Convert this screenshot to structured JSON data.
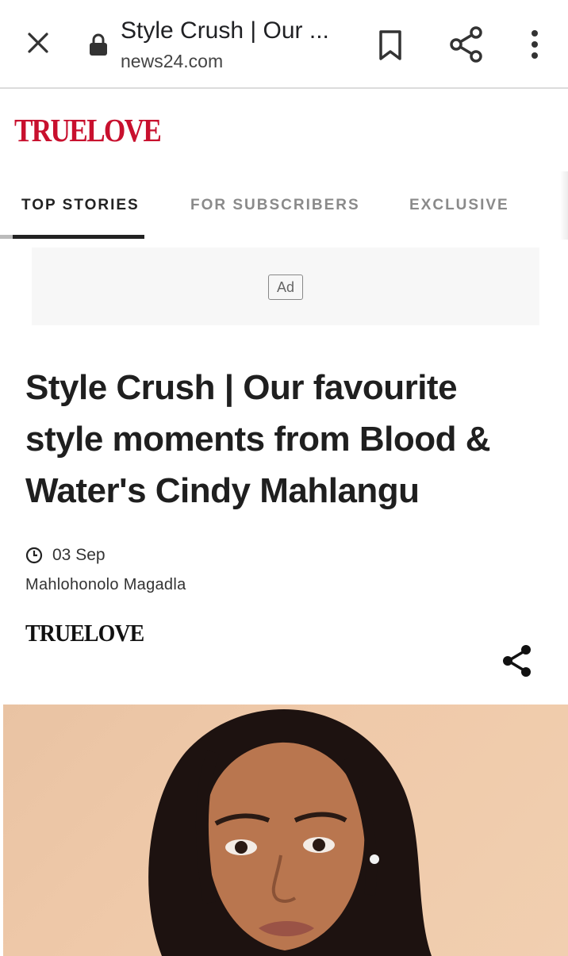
{
  "browser": {
    "page_title": "Style Crush | Our ...",
    "url": "news24.com",
    "icons": {
      "close": "close-icon",
      "lock": "lock-icon",
      "bookmark": "bookmark-icon",
      "share": "share-icon",
      "more": "more-vert-icon"
    }
  },
  "brand": {
    "logo_text": "TRUELOVE",
    "color": "#c8102e"
  },
  "nav": {
    "tabs": [
      {
        "label": "TOP STORIES",
        "active": true
      },
      {
        "label": "FOR SUBSCRIBERS",
        "active": false
      },
      {
        "label": "EXCLUSIVE",
        "active": false
      }
    ]
  },
  "ad": {
    "label": "Ad"
  },
  "article": {
    "headline": "Style Crush | Our favourite style moments from Blood & Water's Cindy Mahlangu",
    "date": "03 Sep",
    "author": "Mahlohonolo Magadla",
    "source_logo": "TRUELOVE"
  },
  "colors": {
    "accent": "#c8102e",
    "text": "#1f1f1f",
    "muted_tab": "#8a8a8a"
  }
}
